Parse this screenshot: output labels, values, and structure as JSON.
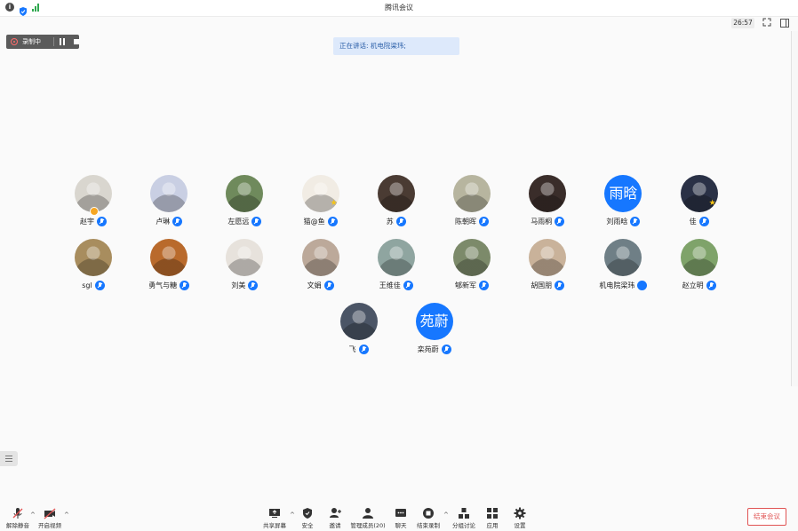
{
  "window": {
    "title": "腾讯会议",
    "timer": "26:57"
  },
  "recording": {
    "label": "录制中"
  },
  "speaking_banner": "正在讲话: 机电院梁玮;",
  "participants": [
    {
      "name": "赵宇",
      "avatar": "photo",
      "bg": "#d9d6cf",
      "mic": "on",
      "host": true
    },
    {
      "name": "卢琳",
      "avatar": "photo",
      "bg": "#c9cfe3",
      "mic": "on"
    },
    {
      "name": "左愿远",
      "avatar": "photo",
      "bg": "#6f8a5c",
      "mic": "on"
    },
    {
      "name": "猫@鱼",
      "avatar": "photo",
      "bg": "#f1ece4",
      "mic": "on",
      "star": true
    },
    {
      "name": "苏",
      "avatar": "photo",
      "bg": "#4a3b33",
      "mic": "on"
    },
    {
      "name": "陈朝晖",
      "avatar": "photo",
      "bg": "#b7b59f",
      "mic": "on"
    },
    {
      "name": "马雨桐",
      "avatar": "photo",
      "bg": "#3a2d2a",
      "mic": "on"
    },
    {
      "name": "刘雨晗",
      "avatar": "text",
      "text": "雨晗",
      "mic": "on"
    },
    {
      "name": "佳",
      "avatar": "photo",
      "bg": "#2a3146",
      "mic": "on",
      "star": true
    },
    {
      "name": "sgl",
      "avatar": "photo",
      "bg": "#a88d5e",
      "mic": "on"
    },
    {
      "name": "勇气与糖",
      "avatar": "photo",
      "bg": "#b96a2c",
      "mic": "on"
    },
    {
      "name": "刘美",
      "avatar": "photo",
      "bg": "#e7e2dc",
      "mic": "on"
    },
    {
      "name": "文娟",
      "avatar": "photo",
      "bg": "#bca99a",
      "mic": "on"
    },
    {
      "name": "王维佳",
      "avatar": "photo",
      "bg": "#8fa5a0",
      "mic": "on"
    },
    {
      "name": "郇新军",
      "avatar": "photo",
      "bg": "#7c8a6a",
      "mic": "on"
    },
    {
      "name": "胡国朋",
      "avatar": "photo",
      "bg": "#c9b29a",
      "mic": "on"
    },
    {
      "name": "机电院梁玮",
      "avatar": "photo",
      "bg": "#6f7f86",
      "mic": "speaking"
    },
    {
      "name": "赵立明",
      "avatar": "photo",
      "bg": "#7fa36a",
      "mic": "on"
    },
    {
      "name": "飞",
      "avatar": "photo",
      "bg": "#4b5566",
      "mic": "on"
    },
    {
      "name": "栾苑蔚",
      "avatar": "text",
      "text": "苑蔚",
      "mic": "on"
    }
  ],
  "toolbar": {
    "unmute": "解除静音",
    "start_video": "开启视频",
    "share_screen": "共享屏幕",
    "security": "安全",
    "invite": "邀请",
    "manage_members": "管理成员(20)",
    "chat": "聊天",
    "stop_recording": "结束录制",
    "breakout": "分组讨论",
    "apps": "应用",
    "settings": "设置",
    "end_meeting": "结束会议"
  },
  "colors": {
    "accent": "#1677ff",
    "danger": "#e05454",
    "banner_bg": "#dde9fb"
  }
}
